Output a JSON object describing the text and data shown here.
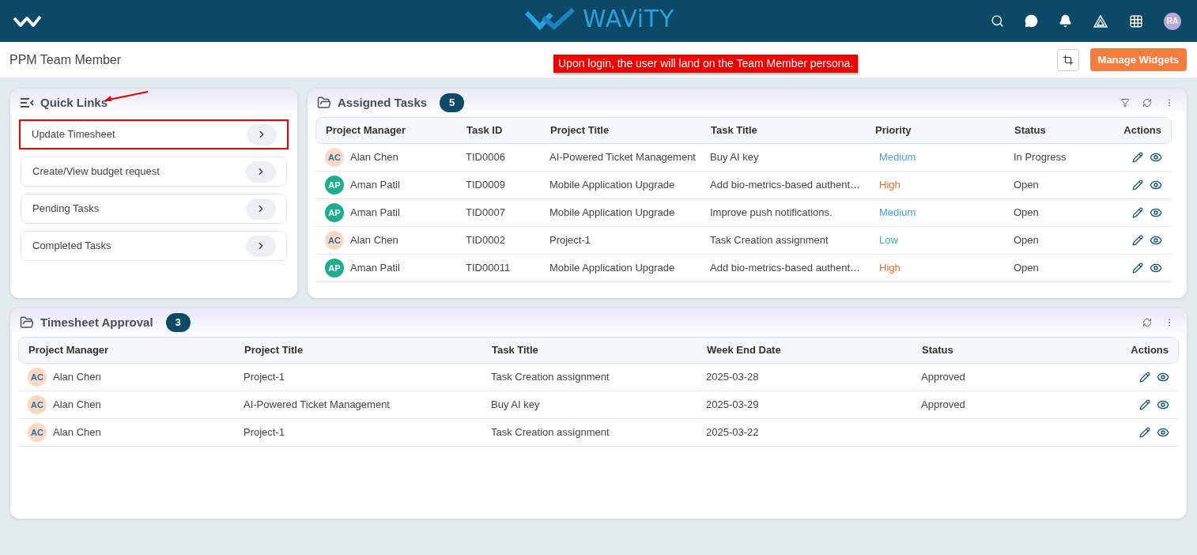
{
  "header": {
    "brand": "WAViTY",
    "avatar": "RA"
  },
  "subheader": {
    "title": "PPM Team Member",
    "callout": "Upon login, the user will land on the Team Member persona.",
    "button": "Manage Widgets"
  },
  "quick_links": {
    "title": "Quick Links",
    "items": [
      {
        "label": "Update Timesheet",
        "highlighted": true
      },
      {
        "label": "Create/View budget request",
        "highlighted": false
      },
      {
        "label": "Pending Tasks",
        "highlighted": false
      },
      {
        "label": "Completed Tasks",
        "highlighted": false
      }
    ]
  },
  "assigned_tasks": {
    "title": "Assigned Tasks",
    "count": "5",
    "columns": [
      "Project Manager",
      "Task ID",
      "Project Title",
      "Task Title",
      "Priority",
      "Status",
      "Actions"
    ],
    "rows": [
      {
        "avatar": {
          "initials": "AC",
          "color": "#fcd9c4"
        },
        "manager": "Alan Chen",
        "task_id": "TID0006",
        "project": "AI-Powered Ticket Management",
        "task": "Buy AI key",
        "priority": {
          "label": "Medium",
          "color": "#4a9fd4"
        },
        "status": "In Progress"
      },
      {
        "avatar": {
          "initials": "AP",
          "color": "#1fae8c"
        },
        "manager": "Aman Patil",
        "task_id": "TID0009",
        "project": "Mobile Application Upgrade",
        "task": "Add bio-metrics-based authent…",
        "priority": {
          "label": "High",
          "color": "#e0712c"
        },
        "status": "Open"
      },
      {
        "avatar": {
          "initials": "AP",
          "color": "#1fae8c"
        },
        "manager": "Aman Patil",
        "task_id": "TID0007",
        "project": "Mobile Application Upgrade",
        "task": "Improve push notifications.",
        "priority": {
          "label": "Medium",
          "color": "#4a9fd4"
        },
        "status": "Open"
      },
      {
        "avatar": {
          "initials": "AC",
          "color": "#fcd9c4"
        },
        "manager": "Alan Chen",
        "task_id": "TID0002",
        "project": "Project-1",
        "task": "Task Creation assignment",
        "priority": {
          "label": "Low",
          "color": "#2fc0a0"
        },
        "status": "Open"
      },
      {
        "avatar": {
          "initials": "AP",
          "color": "#1fae8c"
        },
        "manager": "Aman Patil",
        "task_id": "TID00011",
        "project": "Mobile Application Upgrade",
        "task": "Add bio-metrics-based authent…",
        "priority": {
          "label": "High",
          "color": "#e0712c"
        },
        "status": "Open"
      }
    ]
  },
  "timesheet_approval": {
    "title": "Timesheet Approval",
    "count": "3",
    "columns": [
      "Project Manager",
      "Project Title",
      "Task Title",
      "Week End Date",
      "Status",
      "Actions"
    ],
    "rows": [
      {
        "avatar": {
          "initials": "AC",
          "color": "#fcd9c4"
        },
        "manager": "Alan Chen",
        "project": "Project-1",
        "task": "Task Creation assignment",
        "week_end": "2025-03-28",
        "status": "Approved"
      },
      {
        "avatar": {
          "initials": "AC",
          "color": "#fcd9c4"
        },
        "manager": "Alan Chen",
        "project": "AI-Powered Ticket Management",
        "task": "Buy AI key",
        "week_end": "2025-03-29",
        "status": "Approved"
      },
      {
        "avatar": {
          "initials": "AC",
          "color": "#fcd9c4"
        },
        "manager": "Alan Chen",
        "project": "Project-1",
        "task": "Task Creation assignment",
        "week_end": "2025-03-22"
      }
    ]
  }
}
